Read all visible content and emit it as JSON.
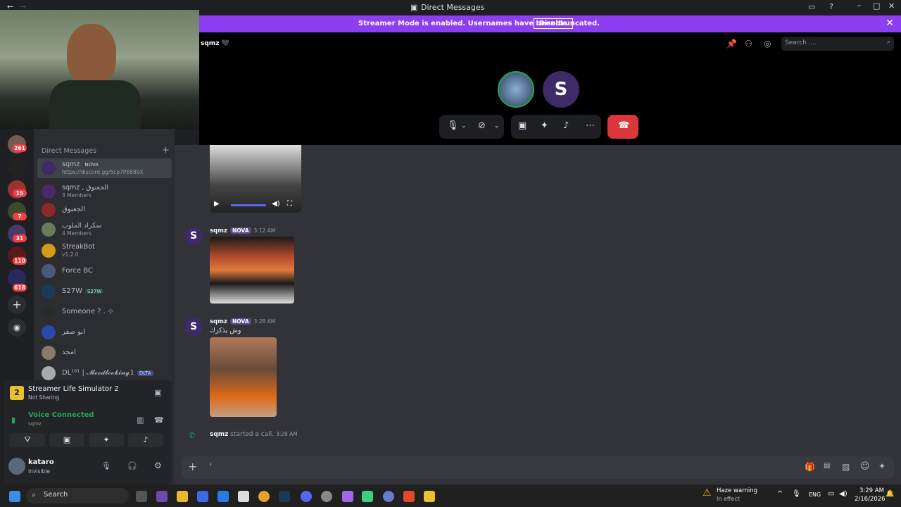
{
  "window": {
    "title": "Direct Messages"
  },
  "banner": {
    "message": "Streamer Mode is enabled. Usernames have been truncated.",
    "disable_label": "Disable"
  },
  "call": {
    "channel_name": "sqmz 🖤",
    "search_placeholder": "Search ...."
  },
  "rail": {
    "badges": [
      "261",
      "15",
      "7",
      "31",
      "110",
      "618"
    ]
  },
  "dm_list": {
    "header": "Direct Messages",
    "items": [
      {
        "name": "sqmz",
        "tag": "NOVA",
        "sub": "https://discord.gg/5cp7PE889X"
      },
      {
        "name": "sqmz , الجعنوق",
        "sub": "3 Members"
      },
      {
        "name": "الجعنوق",
        "sub": ""
      },
      {
        "name": "سكراد الملوب",
        "sub": "4 Members"
      },
      {
        "name": "StreakBot",
        "sub": "v1.2.0"
      },
      {
        "name": "Force BC",
        "sub": ""
      },
      {
        "name": "S27W",
        "tag": "S27W",
        "sub": ""
      },
      {
        "name": "Someone ? . ⊹",
        "sub": ""
      },
      {
        "name": "ابو صقر",
        "sub": ""
      },
      {
        "name": "امجد",
        "sub": ""
      },
      {
        "name": "DL¹⁰¹ | 𝓜𝓸𝓸𝓭𝓵𝓸𝓸𝓴𝓲𝓷𝓰1",
        "tag": "DLTA",
        "sub": ""
      }
    ]
  },
  "activity": {
    "game": "Streamer Life Simulator 2",
    "status": "Not Sharing"
  },
  "voice": {
    "status": "Voice Connected",
    "channel": "sqmz"
  },
  "user": {
    "name": "kataro",
    "status": "Invisible"
  },
  "messages": [
    {
      "author": "sqmz",
      "tag": "NOVA",
      "time": "3:12 AM",
      "text": ""
    },
    {
      "author": "sqmz",
      "tag": "NOVA",
      "time": "3:28 AM",
      "text": "وش يذكرك"
    }
  ],
  "system_message": {
    "author": "sqmz",
    "text": "started a call.",
    "time": "3:28 AM"
  },
  "composer": {
    "text": "'"
  },
  "taskbar": {
    "search": "Search",
    "weather_title": "Haze warning",
    "weather_sub": "In effect",
    "lang": "ENG",
    "time": "3:29 AM",
    "date": "2/16/2026"
  }
}
